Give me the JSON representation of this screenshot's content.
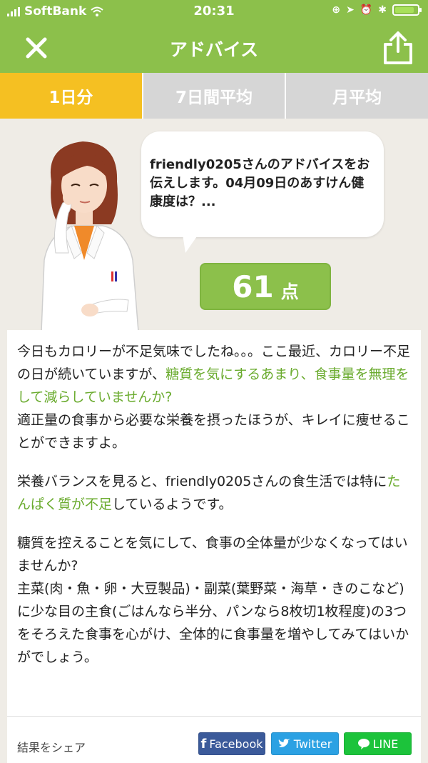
{
  "status_bar": {
    "carrier": "SoftBank",
    "time": "20:31"
  },
  "nav": {
    "title": "アドバイス",
    "close_icon": "close-x-icon",
    "share_icon": "share-icon"
  },
  "tabs": [
    {
      "label": "1日分",
      "active": true
    },
    {
      "label": "7日間平均",
      "active": false
    },
    {
      "label": "月平均",
      "active": false
    }
  ],
  "speech": {
    "text": "friendly0205さんのアドバイスをお伝えします。04月09日のあすけん健康度は？..."
  },
  "score": {
    "value": "61",
    "unit": "点"
  },
  "advice": {
    "p1_a": "今日もカロリーが不足気味でしたね。。。ここ最近、カロリー不足の日が続いていますが、",
    "p1_hl": "糖質を気にするあまり、食事量を無理をして減らしていませんか?",
    "p1_b": "適正量の食事から必要な栄養を摂ったほうが、キレイに痩せることができますよ。",
    "p2_a": "栄養バランスを見ると、friendly0205さんの食生活では特に",
    "p2_hl": "たんぱく質が不足",
    "p2_b": "しているようです。",
    "p3": "糖質を控えることを気にして、食事の全体量が少なくなってはいませんか?\n主菜(肉・魚・卵・大豆製品)・副菜(葉野菜・海草・きのこなど)に少な目の主食(ごはんなら半分、パンなら8枚切1枚程度)の3つをそろえた食事を心がけ、全体的に食事量を増やしてみてはいかがでしょう。"
  },
  "share": {
    "label": "結果をシェア",
    "facebook": "Facebook",
    "twitter": "Twitter",
    "line": "LINE"
  },
  "colors": {
    "brand_green": "#8cc04b",
    "tab_active": "#f5c022",
    "highlight_green": "#6aab2e"
  }
}
